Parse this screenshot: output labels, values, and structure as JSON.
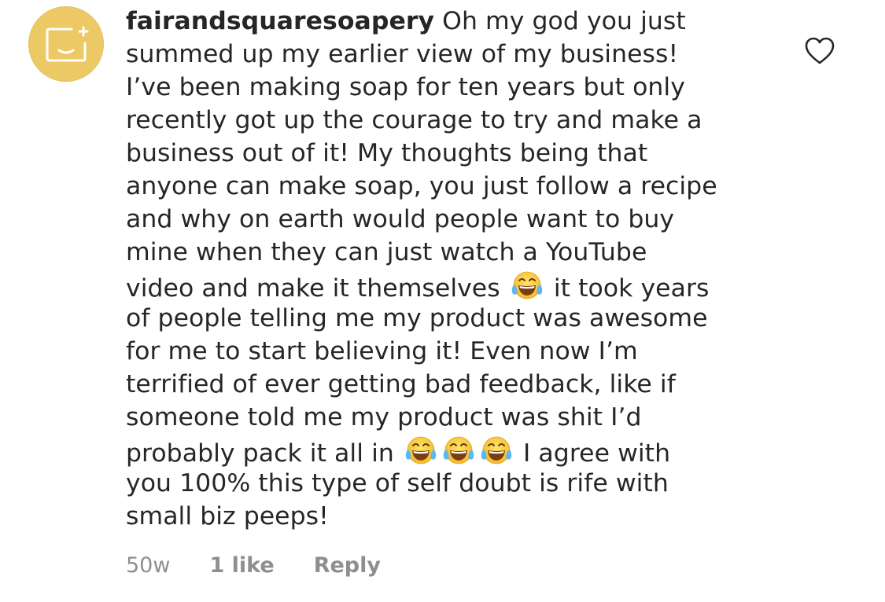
{
  "comment": {
    "username": "fairandsquaresoapery",
    "lines": [
      " Oh my god you just",
      "summed up my earlier view of my business!",
      "I’ve been making soap for ten years but only",
      "recently got up the courage to try and make a",
      "business out of it! My thoughts being that",
      "anyone can make soap, you just follow a recipe",
      "and why on earth would people want to buy",
      "mine when they can just watch a YouTube"
    ],
    "line9_before": "video and make it themselves ",
    "line9_after": " it took years",
    "lines_mid": [
      "of people telling me my product was awesome",
      "for me to start believing it! Even now I’m",
      "terrified of ever getting bad feedback, like if",
      "someone told me my product was shit I’d"
    ],
    "line14_before": "probably pack it all in ",
    "line14_after": " I agree with",
    "lines_end": [
      "you 100% this type of self doubt is rife with",
      "small biz peeps!"
    ],
    "emoji_icon": "face-with-tears-of-joy-icon"
  },
  "meta": {
    "age": "50w",
    "likes": "1 like",
    "reply_label": "Reply"
  },
  "colors": {
    "avatar_bg": "#ecc964",
    "text": "#262626",
    "meta_text": "#8e8e8e"
  }
}
